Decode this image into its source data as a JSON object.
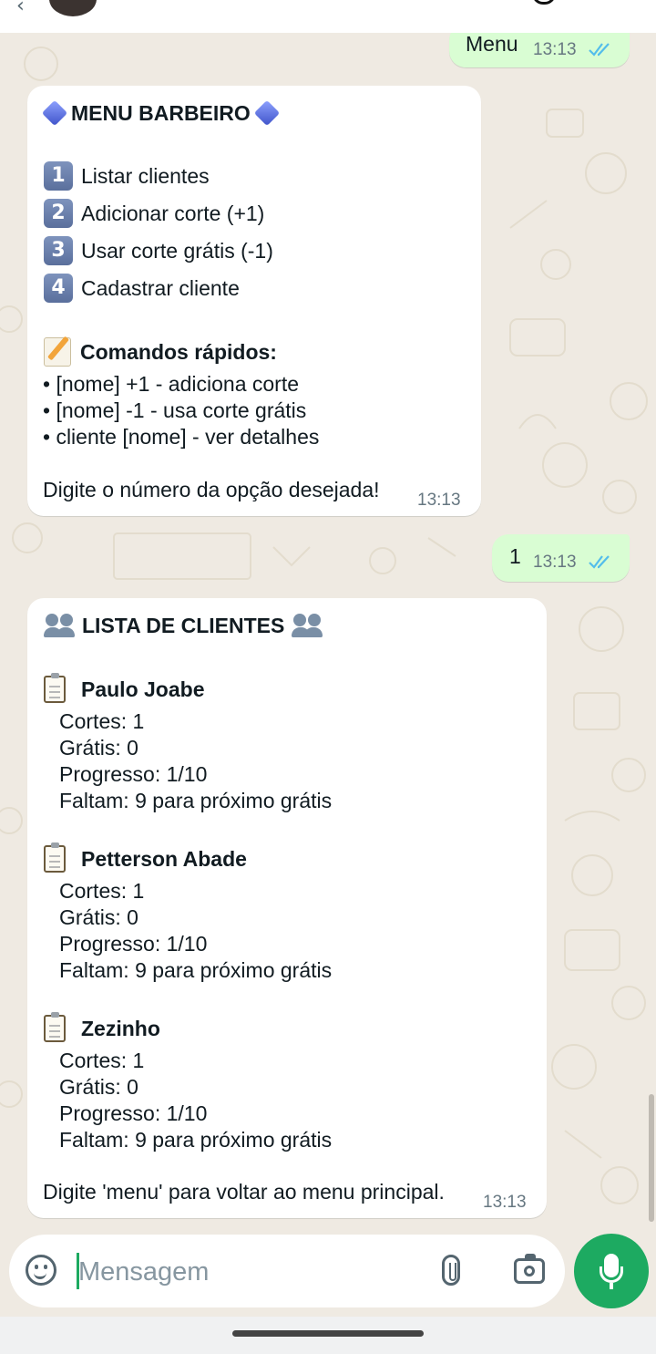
{
  "composer": {
    "placeholder": "Mensagem",
    "icons": [
      "sticker-icon",
      "attach-icon",
      "camera-icon",
      "mic-icon"
    ]
  },
  "messages": {
    "m1": {
      "direction": "outgoing",
      "text": "Menu",
      "time": "13:13",
      "status": "read"
    },
    "m2": {
      "direction": "incoming",
      "title": "MENU BARBEIRO",
      "options": [
        {
          "num": "1",
          "label": "Listar clientes"
        },
        {
          "num": "2",
          "label": "Adicionar corte (+1)"
        },
        {
          "num": "3",
          "label": "Usar corte grátis (-1)"
        },
        {
          "num": "4",
          "label": "Cadastrar cliente"
        }
      ],
      "quick_title": "Comandos rápidos:",
      "quick": [
        "• [nome] +1 - adiciona corte",
        "• [nome] -1 - usa corte grátis",
        "• cliente [nome] - ver detalhes"
      ],
      "footer": "Digite o número da opção desejada!",
      "time": "13:13"
    },
    "m3": {
      "direction": "outgoing",
      "text": "1",
      "time": "13:13",
      "status": "read"
    },
    "m4": {
      "direction": "incoming",
      "title": "LISTA DE CLIENTES",
      "clients": [
        {
          "name": "Paulo Joabe",
          "lines": [
            "Cortes: 1",
            "Grátis: 0",
            "Progresso: 1/10",
            "Faltam: 9 para próximo grátis"
          ]
        },
        {
          "name": "Petterson Abade",
          "lines": [
            "Cortes: 1",
            "Grátis: 0",
            "Progresso: 1/10",
            "Faltam: 9 para próximo grátis"
          ]
        },
        {
          "name": "Zezinho",
          "lines": [
            "Cortes: 1",
            "Grátis: 0",
            "Progresso: 1/10",
            "Faltam: 9 para próximo grátis"
          ]
        }
      ],
      "footer": "Digite 'menu' para voltar ao menu principal.",
      "time": "13:13"
    }
  },
  "colors": {
    "outgoing_bubble": "#d9fdd3",
    "incoming_bubble": "#ffffff",
    "chat_bg": "#efeae2",
    "accent": "#1daa61"
  }
}
